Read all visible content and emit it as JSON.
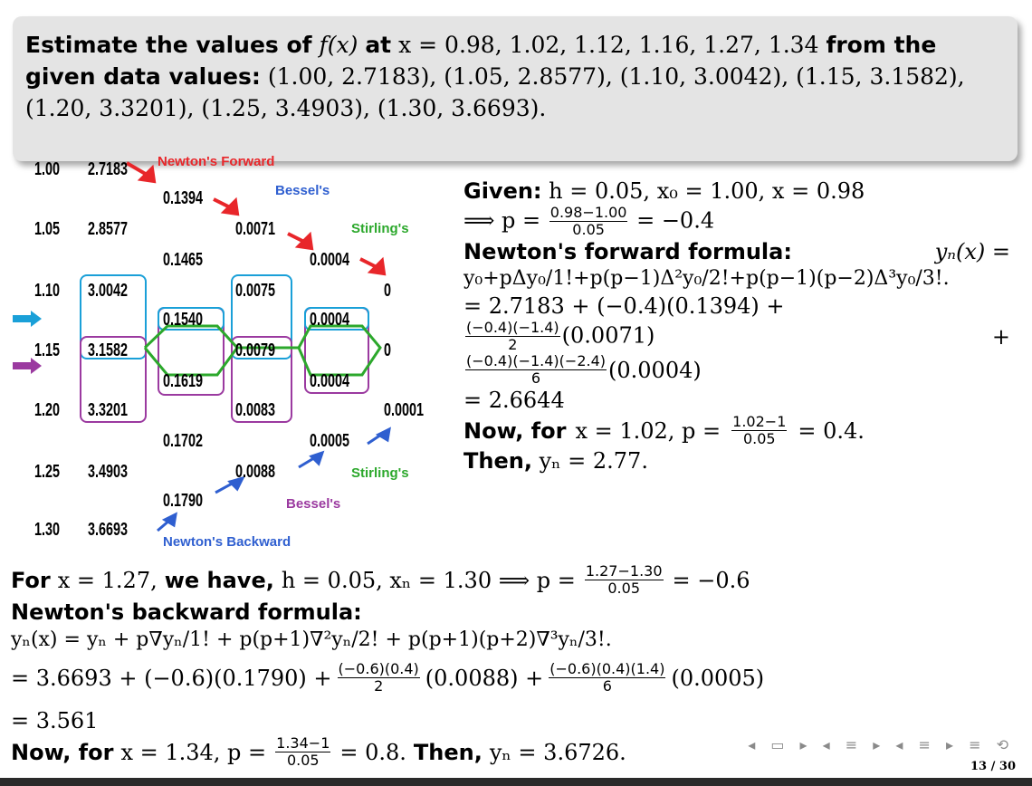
{
  "problem": {
    "lead": "Estimate the values of",
    "fx": "f(x)",
    "at": "at",
    "xeq": "x = 0.98, 1.02, 1.12, 1.16, 1.27, 1.34",
    "from": "from the given data values:",
    "pairs1": "(1.00, 2.7183), (1.05, 2.8577), (1.10, 3.0042), (1.15, 3.1582),",
    "pairs2": "(1.20, 3.3201), (1.25, 3.4903), (1.30, 3.6693)."
  },
  "table": {
    "x": [
      "1.00",
      "1.05",
      "1.10",
      "1.15",
      "1.20",
      "1.25",
      "1.30"
    ],
    "y": [
      "2.7183",
      "2.8577",
      "3.0042",
      "3.1582",
      "3.3201",
      "3.4903",
      "3.6693"
    ],
    "d1": [
      "0.1394",
      "0.1465",
      "0.1540",
      "0.1619",
      "0.1702",
      "0.1790"
    ],
    "d2": [
      "0.0071",
      "0.0075",
      "0.0079",
      "0.0083",
      "0.0088"
    ],
    "d3": [
      "0.0004",
      "0.0004",
      "0.0004",
      "0.0005"
    ],
    "d4": [
      "0",
      "0",
      "0.0001"
    ],
    "labels": {
      "nf": "Newton's Forward",
      "bessel_top": "Bessel's",
      "stirling_top": "Stirling's",
      "stirling_bot": "Stirling's",
      "bessel_bot": "Bessel's",
      "nb": "Newton's Backward"
    },
    "colors": {
      "red": "#e8262a",
      "blue": "#2f5fd0",
      "green": "#2ca82c",
      "cyan": "#1aa0d8",
      "purple": "#9b3aa0"
    }
  },
  "right": {
    "given_label": "Given:",
    "given_expr": "h = 0.05, x₀ = 1.00, x = 0.98",
    "implies": "⟹ p =",
    "p_num": "0.98−1.00",
    "p_den": "0.05",
    "p_val": "= −0.4",
    "nf_label": "Newton's forward formula:",
    "nf_lhs": "yₙ(x) =",
    "nf_formula": "y₀+pΔy₀/1!+p(p−1)Δ²y₀/2!+p(p−1)(p−2)Δ³y₀/3!.",
    "sub1": "= 2.7183 + (−0.4)(0.1394) +",
    "sub2_num": "(−0.4)(−1.4)",
    "sub2_den": "2",
    "sub2_tail": "(0.0071)",
    "sub3_num": "(−0.4)(−1.4)(−2.4)",
    "sub3_den": "6",
    "sub3_tail": "(0.0004)",
    "result": "= 2.6644",
    "now_label": "Now, for",
    "now_expr": "x = 1.02, p =",
    "now_num": "1.02−1",
    "now_den": "0.05",
    "now_val": "= 0.4.",
    "then_label": "Then,",
    "then_val": "yₙ = 2.77."
  },
  "bottom": {
    "for_label": "For",
    "for_x": "x = 1.27,",
    "we_have": "we have,",
    "h_expr": "h = 0.05, xₙ = 1.30 ⟹ p =",
    "p_num": "1.27−1.30",
    "p_den": "0.05",
    "p_val": "= −0.6",
    "nb_label": "Newton's backward formula:",
    "nb_formula": "yₙ(x) = yₙ + p∇yₙ/1! + p(p+1)∇²yₙ/2! + p(p+1)(p+2)∇³yₙ/3!.",
    "sub_a": "= 3.6693 + (−0.6)(0.1790) +",
    "sub_b_num": "(−0.6)(0.4)",
    "sub_b_den": "2",
    "sub_b_tail": "(0.0088) +",
    "sub_c_num": "(−0.6)(0.4)(1.4)",
    "sub_c_den": "6",
    "sub_c_tail": "(0.0005)",
    "result": "= 3.561",
    "now_label": "Now, for",
    "now_expr": "x = 1.34, p =",
    "now_num": "1.34−1",
    "now_den": "0.05",
    "now_val": "= 0.8.",
    "then_label": "Then,",
    "then_val": "yₙ = 3.6726."
  },
  "page": "13 / 30"
}
